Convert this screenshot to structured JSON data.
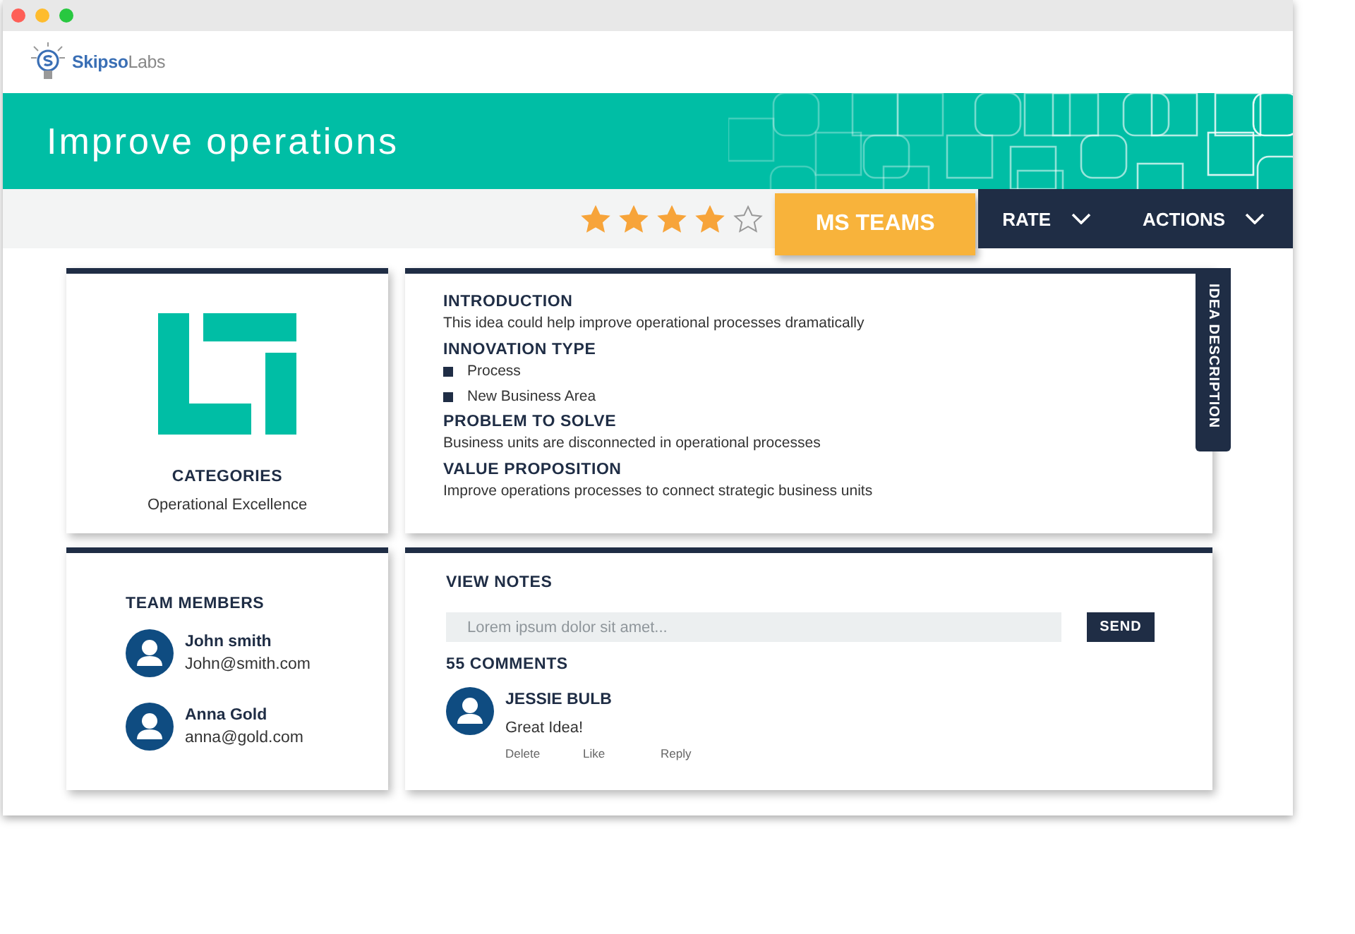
{
  "logo": {
    "text": "**Skipso**Labs"
  },
  "banner": {
    "title": "Improve operations"
  },
  "toolbar": {
    "stars": 4,
    "buttons": [
      {
        "label": "MS TEAMS",
        "kind": "highlight"
      },
      {
        "label": "RATE",
        "kind": "menu"
      },
      {
        "label": "ACTIONS",
        "kind": "menu"
      }
    ]
  },
  "category_card": {
    "heading": "CATEGORIES",
    "value": "Operational Excellence"
  },
  "description": {
    "tab": "IDEA DESCRIPTION",
    "sections": [
      {
        "kind": "text",
        "heading": "INTRODUCTION",
        "text": "This idea could help improve operational processes dramatically"
      },
      {
        "kind": "list",
        "heading": "INNOVATION TYPE",
        "items": [
          "Process",
          "New Business Area"
        ]
      },
      {
        "kind": "text",
        "heading": "PROBLEM TO SOLVE",
        "text": "Business units are disconnected in operational processes"
      },
      {
        "kind": "text",
        "heading": "VALUE PROPOSITION",
        "text": "Improve operations processes to connect strategic business units"
      }
    ]
  },
  "team": {
    "heading": "TEAM MEMBERS",
    "members": [
      {
        "name": "John smith",
        "email": "John@smith.com"
      },
      {
        "name": "Anna Gold",
        "email": "anna@gold.com"
      }
    ]
  },
  "notes": {
    "heading": "VIEW NOTES",
    "input": {
      "placeholder": "Lorem ipsum dolor sit amet..."
    },
    "send": "SEND",
    "count": "55 COMMENTS",
    "comments": [
      {
        "author": "JESSIE BULB",
        "text": "Great Idea!",
        "actions": [
          "Delete",
          "Like",
          "Reply"
        ]
      }
    ]
  }
}
